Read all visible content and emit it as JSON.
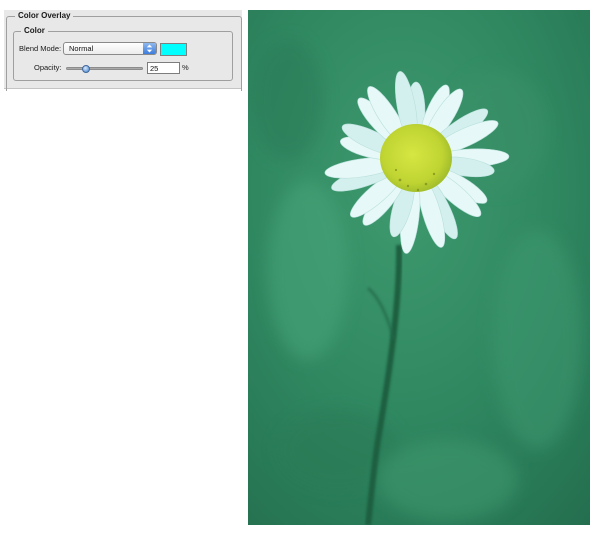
{
  "panel": {
    "section_title": "Color Overlay",
    "subsection_title": "Color",
    "blend_mode_label": "Blend Mode:",
    "blend_mode_value": "Normal",
    "overlay_color": "#00ffff",
    "opacity_label": "Opacity:",
    "opacity_value": "25",
    "opacity_fraction": 0.25,
    "opacity_unit": "%"
  },
  "photo": {
    "overlay_tint": "#1f7a5a"
  }
}
